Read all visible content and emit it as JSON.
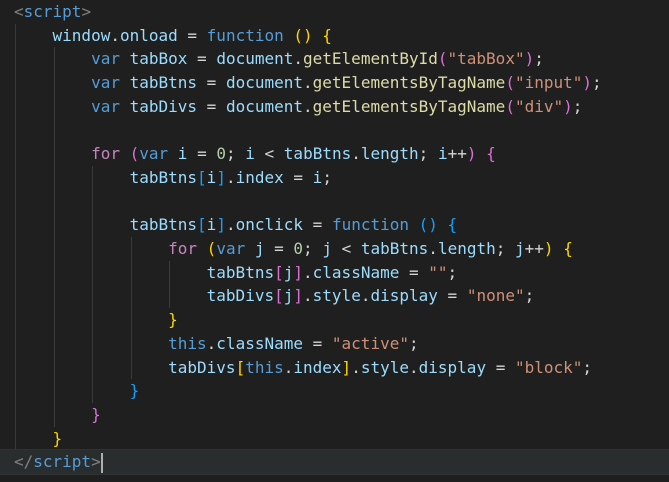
{
  "editor": {
    "language": "html",
    "lines": [
      [
        {
          "t": "<",
          "c": "t-tag"
        },
        {
          "t": "script",
          "c": "t-tagn"
        },
        {
          "t": ">",
          "c": "t-tag"
        }
      ],
      [
        {
          "t": "    "
        },
        {
          "t": "window",
          "c": "t-var"
        },
        {
          "t": "."
        },
        {
          "t": "onload",
          "c": "t-var"
        },
        {
          "t": " = "
        },
        {
          "t": "function",
          "c": "t-kw"
        },
        {
          "t": " "
        },
        {
          "t": "()",
          "c": "t-b1"
        },
        {
          "t": " "
        },
        {
          "t": "{",
          "c": "t-b1"
        }
      ],
      [
        {
          "t": "        "
        },
        {
          "t": "var",
          "c": "t-kw"
        },
        {
          "t": " "
        },
        {
          "t": "tabBox",
          "c": "t-var"
        },
        {
          "t": " = "
        },
        {
          "t": "document",
          "c": "t-var"
        },
        {
          "t": "."
        },
        {
          "t": "getElementById",
          "c": "t-fn"
        },
        {
          "t": "(",
          "c": "t-b2"
        },
        {
          "t": "\"tabBox\"",
          "c": "t-str"
        },
        {
          "t": ")",
          "c": "t-b2"
        },
        {
          "t": ";"
        }
      ],
      [
        {
          "t": "        "
        },
        {
          "t": "var",
          "c": "t-kw"
        },
        {
          "t": " "
        },
        {
          "t": "tabBtns",
          "c": "t-var"
        },
        {
          "t": " = "
        },
        {
          "t": "document",
          "c": "t-var"
        },
        {
          "t": "."
        },
        {
          "t": "getElementsByTagName",
          "c": "t-fn"
        },
        {
          "t": "(",
          "c": "t-b2"
        },
        {
          "t": "\"input\"",
          "c": "t-str"
        },
        {
          "t": ")",
          "c": "t-b2"
        },
        {
          "t": ";"
        }
      ],
      [
        {
          "t": "        "
        },
        {
          "t": "var",
          "c": "t-kw"
        },
        {
          "t": " "
        },
        {
          "t": "tabDivs",
          "c": "t-var"
        },
        {
          "t": " = "
        },
        {
          "t": "document",
          "c": "t-var"
        },
        {
          "t": "."
        },
        {
          "t": "getElementsByTagName",
          "c": "t-fn"
        },
        {
          "t": "(",
          "c": "t-b2"
        },
        {
          "t": "\"div\"",
          "c": "t-str"
        },
        {
          "t": ")",
          "c": "t-b2"
        },
        {
          "t": ";"
        }
      ],
      [],
      [
        {
          "t": "        "
        },
        {
          "t": "for",
          "c": "t-ctrl"
        },
        {
          "t": " "
        },
        {
          "t": "(",
          "c": "t-b2"
        },
        {
          "t": "var",
          "c": "t-kw"
        },
        {
          "t": " "
        },
        {
          "t": "i",
          "c": "t-var"
        },
        {
          "t": " = "
        },
        {
          "t": "0",
          "c": "t-num"
        },
        {
          "t": "; "
        },
        {
          "t": "i",
          "c": "t-var"
        },
        {
          "t": " < "
        },
        {
          "t": "tabBtns",
          "c": "t-var"
        },
        {
          "t": "."
        },
        {
          "t": "length",
          "c": "t-var"
        },
        {
          "t": "; "
        },
        {
          "t": "i",
          "c": "t-var"
        },
        {
          "t": "++"
        },
        {
          "t": ")",
          "c": "t-b2"
        },
        {
          "t": " "
        },
        {
          "t": "{",
          "c": "t-b2"
        }
      ],
      [
        {
          "t": "            "
        },
        {
          "t": "tabBtns",
          "c": "t-var"
        },
        {
          "t": "[",
          "c": "t-b3"
        },
        {
          "t": "i",
          "c": "t-var"
        },
        {
          "t": "]",
          "c": "t-b3"
        },
        {
          "t": "."
        },
        {
          "t": "index",
          "c": "t-var"
        },
        {
          "t": " = "
        },
        {
          "t": "i",
          "c": "t-var"
        },
        {
          "t": ";"
        }
      ],
      [],
      [
        {
          "t": "            "
        },
        {
          "t": "tabBtns",
          "c": "t-var"
        },
        {
          "t": "[",
          "c": "t-b3"
        },
        {
          "t": "i",
          "c": "t-var"
        },
        {
          "t": "]",
          "c": "t-b3"
        },
        {
          "t": "."
        },
        {
          "t": "onclick",
          "c": "t-var"
        },
        {
          "t": " = "
        },
        {
          "t": "function",
          "c": "t-kw"
        },
        {
          "t": " "
        },
        {
          "t": "()",
          "c": "t-b3"
        },
        {
          "t": " "
        },
        {
          "t": "{",
          "c": "t-b3"
        }
      ],
      [
        {
          "t": "                "
        },
        {
          "t": "for",
          "c": "t-ctrl"
        },
        {
          "t": " "
        },
        {
          "t": "(",
          "c": "t-b1"
        },
        {
          "t": "var",
          "c": "t-kw"
        },
        {
          "t": " "
        },
        {
          "t": "j",
          "c": "t-var"
        },
        {
          "t": " = "
        },
        {
          "t": "0",
          "c": "t-num"
        },
        {
          "t": "; "
        },
        {
          "t": "j",
          "c": "t-var"
        },
        {
          "t": " < "
        },
        {
          "t": "tabBtns",
          "c": "t-var"
        },
        {
          "t": "."
        },
        {
          "t": "length",
          "c": "t-var"
        },
        {
          "t": "; "
        },
        {
          "t": "j",
          "c": "t-var"
        },
        {
          "t": "++"
        },
        {
          "t": ")",
          "c": "t-b1"
        },
        {
          "t": " "
        },
        {
          "t": "{",
          "c": "t-b1"
        }
      ],
      [
        {
          "t": "                    "
        },
        {
          "t": "tabBtns",
          "c": "t-var"
        },
        {
          "t": "[",
          "c": "t-b2"
        },
        {
          "t": "j",
          "c": "t-var"
        },
        {
          "t": "]",
          "c": "t-b2"
        },
        {
          "t": "."
        },
        {
          "t": "className",
          "c": "t-var"
        },
        {
          "t": " = "
        },
        {
          "t": "\"\"",
          "c": "t-str"
        },
        {
          "t": ";"
        }
      ],
      [
        {
          "t": "                    "
        },
        {
          "t": "tabDivs",
          "c": "t-var"
        },
        {
          "t": "[",
          "c": "t-b2"
        },
        {
          "t": "j",
          "c": "t-var"
        },
        {
          "t": "]",
          "c": "t-b2"
        },
        {
          "t": "."
        },
        {
          "t": "style",
          "c": "t-var"
        },
        {
          "t": "."
        },
        {
          "t": "display",
          "c": "t-var"
        },
        {
          "t": " = "
        },
        {
          "t": "\"none\"",
          "c": "t-str"
        },
        {
          "t": ";"
        }
      ],
      [
        {
          "t": "                "
        },
        {
          "t": "}",
          "c": "t-b1"
        }
      ],
      [
        {
          "t": "                "
        },
        {
          "t": "this",
          "c": "t-kw"
        },
        {
          "t": "."
        },
        {
          "t": "className",
          "c": "t-var"
        },
        {
          "t": " = "
        },
        {
          "t": "\"active\"",
          "c": "t-str"
        },
        {
          "t": ";"
        }
      ],
      [
        {
          "t": "                "
        },
        {
          "t": "tabDivs",
          "c": "t-var"
        },
        {
          "t": "[",
          "c": "t-b1"
        },
        {
          "t": "this",
          "c": "t-kw"
        },
        {
          "t": "."
        },
        {
          "t": "index",
          "c": "t-var"
        },
        {
          "t": "]",
          "c": "t-b1"
        },
        {
          "t": "."
        },
        {
          "t": "style",
          "c": "t-var"
        },
        {
          "t": "."
        },
        {
          "t": "display",
          "c": "t-var"
        },
        {
          "t": " = "
        },
        {
          "t": "\"block\"",
          "c": "t-str"
        },
        {
          "t": ";"
        }
      ],
      [
        {
          "t": "            "
        },
        {
          "t": "}",
          "c": "t-b3"
        }
      ],
      [
        {
          "t": "        "
        },
        {
          "t": "}",
          "c": "t-b2"
        }
      ],
      [
        {
          "t": "    "
        },
        {
          "t": "}",
          "c": "t-b1"
        }
      ],
      [
        {
          "t": "</",
          "c": "t-tag"
        },
        {
          "t": "script",
          "c": "t-tagn"
        },
        {
          "t": ">",
          "c": "t-tag"
        }
      ]
    ],
    "current_line": 19
  }
}
